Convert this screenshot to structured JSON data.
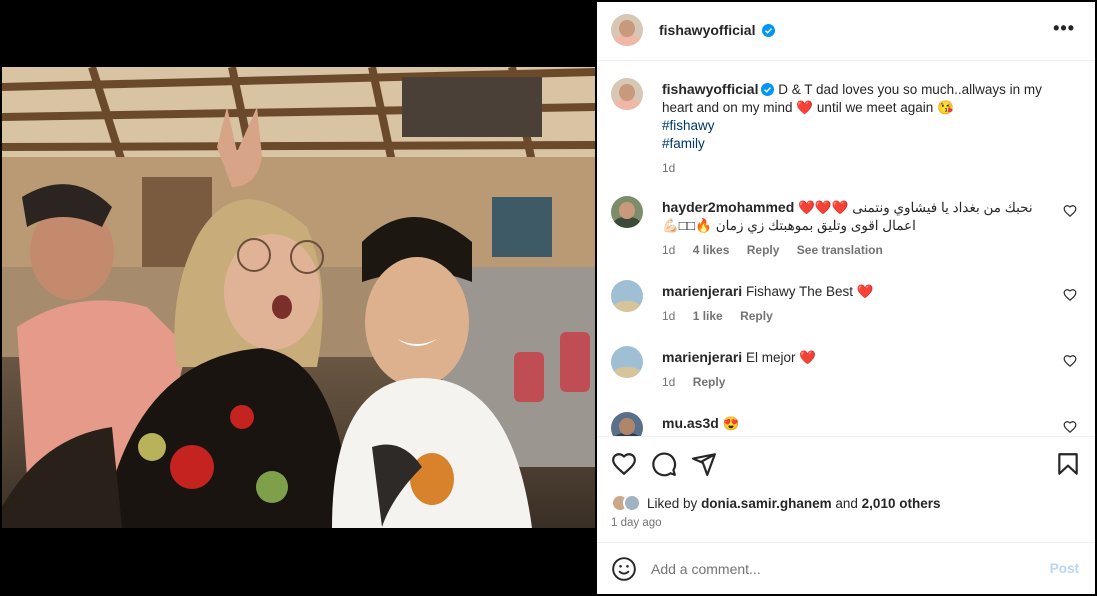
{
  "post": {
    "author": "fishawyofficial",
    "caption_text": "D & T dad loves you so much..allways in my heart and on my mind",
    "caption_heart": "❤️",
    "caption_tail": "until we meet again",
    "caption_emoji": "😘",
    "hashtags": [
      "#fishawy",
      "#family"
    ],
    "caption_age": "1d",
    "more_label": "•••"
  },
  "comments": [
    {
      "username": "hayder2mohammed",
      "text_line1": "❤️❤️❤️ نحبك من بغداد يا فيشاوي ونتمنى",
      "text_line2": "💪🏻□□🔥 اعمال اقوى وتليق بموهبتك زي زمان",
      "age": "1d",
      "likes": "4 likes",
      "reply": "Reply",
      "translate": "See translation"
    },
    {
      "username": "marienjerari",
      "text": "Fishawy The Best",
      "emoji": "❤️",
      "age": "1d",
      "likes": "1 like",
      "reply": "Reply"
    },
    {
      "username": "marienjerari",
      "text": "El mejor",
      "emoji": "❤️",
      "age": "1d",
      "reply": "Reply"
    },
    {
      "username": "mu.as3d",
      "text": "",
      "emoji": "😍"
    }
  ],
  "likes": {
    "prefix": "Liked by",
    "user": "donia.samir.ghanem",
    "middle": "and",
    "others": "2,010 others"
  },
  "post_age": "1 day ago",
  "composer": {
    "placeholder": "Add a comment...",
    "post_label": "Post"
  },
  "colors": {
    "link": "#00376b",
    "muted": "#737373",
    "verified": "#0095f6",
    "post_disabled": "#b7d6f7"
  },
  "icons": [
    "verified-icon",
    "more-icon",
    "heart-icon",
    "comment-icon",
    "share-icon",
    "bookmark-icon",
    "emoji-icon"
  ]
}
